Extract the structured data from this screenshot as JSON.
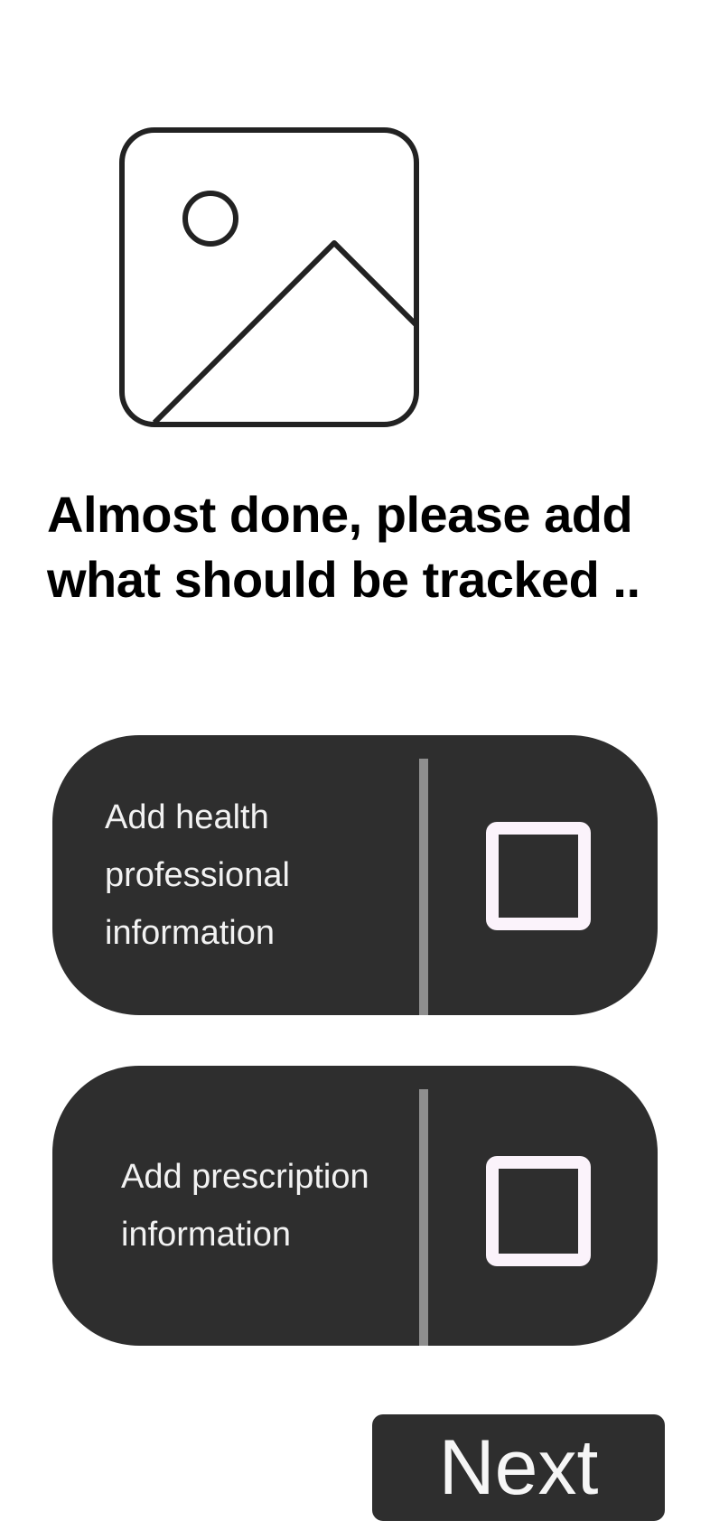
{
  "hero": {
    "icon": "image-placeholder-icon"
  },
  "title": "Almost done, please add what should be tracked ..",
  "options": [
    {
      "label": "Add health professional information",
      "checked": false
    },
    {
      "label": "Add prescription information",
      "checked": false
    }
  ],
  "next_button": {
    "label": "Next"
  },
  "colors": {
    "card_background": "#2e2e2e",
    "divider": "#8e8e8e",
    "checkbox_border": "#fbf3fb",
    "text_on_dark": "#f2f2f2"
  }
}
